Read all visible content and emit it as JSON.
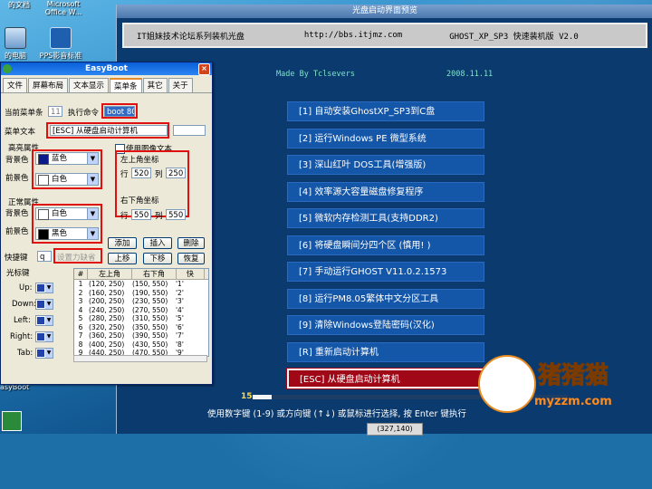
{
  "desktop": {
    "icons": [
      {
        "label": "的文档",
        "top": true
      },
      {
        "label": "Microsoft Office W..."
      },
      {
        "label": "的电脑"
      },
      {
        "label": "PPS影音标准"
      }
    ],
    "easyboot_label": "asyBoot"
  },
  "preview": {
    "title": "光盘启动界面预览",
    "header_left": "IT姐妹技术论坛系列装机光盘",
    "header_url": "http://bbs.itjmz.com",
    "header_right": "GHOST_XP_SP3 快速装机版 V2.0",
    "made_by": "Made By Tclsevers",
    "date": "2008.11.11",
    "menu_items": [
      "[1] 自动安装GhostXP_SP3到C盘",
      "[2] 运行Windows PE 微型系统",
      "[3] 深山红叶 DOS工具(增强版)",
      "[4] 效率源大容量磁盘修复程序",
      "[5] 微软内存检测工具(支持DDR2)",
      "[6] 将硬盘瞬间分四个区 (慎用! )",
      "[7] 手动运行GHOST V11.0.2.1573",
      "[8] 运行PM8.05繁体中文分区工具",
      "[9] 清除Windows登陆密码(汉化)",
      "[R] 重新启动计算机",
      "[ESC] 从硬盘启动计算机"
    ],
    "selected_index": 10,
    "progress_number": "15",
    "progress_fraction": 0.06,
    "hint": "使用数字键 (1-9) 或方向键 (↑↓) 或鼠标进行选择, 按 Enter 键执行",
    "coords": "(327,140)",
    "watermark_cn": "猪猪猫",
    "watermark_url": "myzzm.com"
  },
  "window": {
    "title": "EasyBoot",
    "close_glyph": "×",
    "tabs": [
      "文件",
      "屏幕布局",
      "文本显示",
      "菜单条",
      "其它",
      "关于"
    ],
    "active_tab": 3,
    "current_menu_label": "当前菜单条",
    "current_menu_value": "11",
    "exec_cmd_label": "执行命令",
    "exec_cmd_value": "boot 80",
    "menu_text_label": "菜单文本",
    "menu_text_value": "[ESC] 从硬盘启动计算机",
    "highlight_label": "高亮属性",
    "normal_label": "正常属性",
    "fg_label": "前景色",
    "bg_label": "背景色",
    "highlight_bg": {
      "name": "蓝色",
      "color": "#0a1a8a"
    },
    "highlight_fg": {
      "name": "白色",
      "color": "#ffffff"
    },
    "normal_bg": {
      "name": "白色",
      "color": "#ffffff"
    },
    "normal_fg": {
      "name": "黑色",
      "color": "#000000"
    },
    "use_image_text": "使用图像文本",
    "top_left_label": "左上角坐标",
    "bottom_right_label": "右下角坐标",
    "row_label": "行",
    "col_label": "列",
    "top_left_row": "520",
    "top_left_col": "250",
    "bottom_right_row": "550",
    "bottom_right_col": "550",
    "hotkey_label": "快捷键",
    "hotkey_value": "q",
    "set_pwd": "设置力缺省",
    "btn_add": "添加",
    "btn_insert": "插入",
    "btn_delete": "删除",
    "btn_up": "上移",
    "btn_down": "下移",
    "btn_restore": "恢复",
    "cursor_key_label": "光标键",
    "keys": [
      "Up:",
      "Down:",
      "Left:",
      "Right:",
      "Tab:"
    ],
    "table_headers": [
      "#",
      "左上角",
      "右下角",
      "快"
    ],
    "table_rows": [
      [
        "1",
        "(120, 250)",
        "(150, 550)",
        "'1'"
      ],
      [
        "2",
        "(160, 250)",
        "(190, 550)",
        "'2'"
      ],
      [
        "3",
        "(200, 250)",
        "(230, 550)",
        "'3'"
      ],
      [
        "4",
        "(240, 250)",
        "(270, 550)",
        "'4'"
      ],
      [
        "5",
        "(280, 250)",
        "(310, 550)",
        "'5'"
      ],
      [
        "6",
        "(320, 250)",
        "(350, 550)",
        "'6'"
      ],
      [
        "7",
        "(360, 250)",
        "(390, 550)",
        "'7'"
      ],
      [
        "8",
        "(400, 250)",
        "(430, 550)",
        "'8'"
      ],
      [
        "9",
        "(440, 250)",
        "(470, 550)",
        "'9'"
      ]
    ]
  }
}
